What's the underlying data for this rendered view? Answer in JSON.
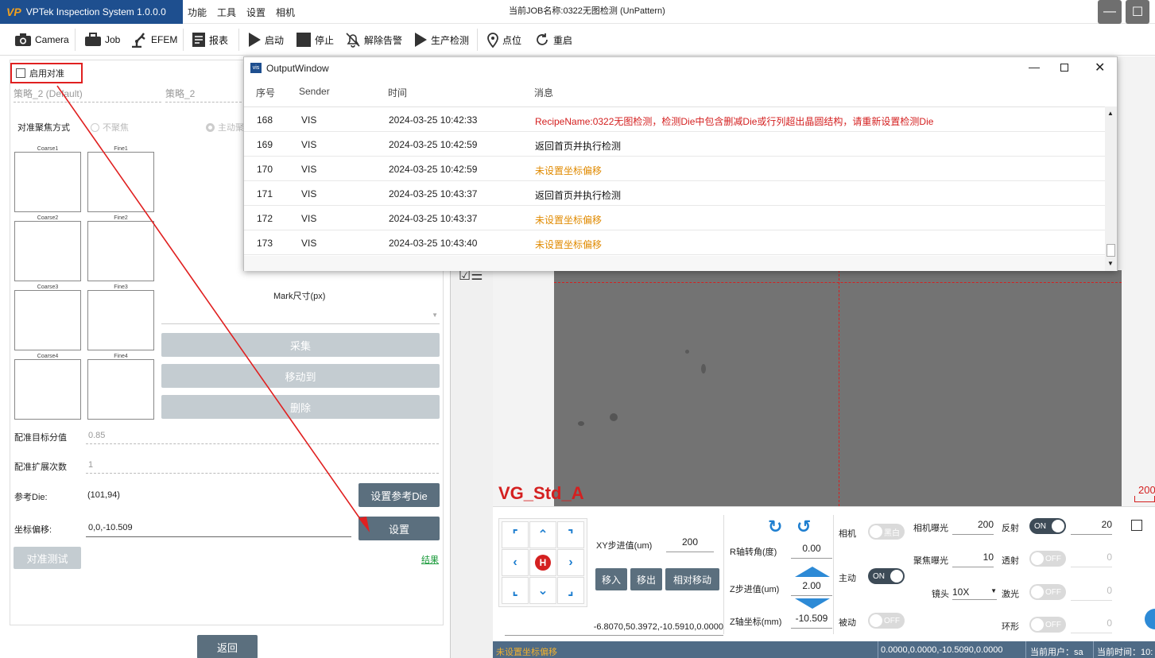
{
  "app": {
    "title": "VPTek Inspection System 1.0.0.0",
    "logo_text": "VP"
  },
  "menu": [
    "功能",
    "工具",
    "设置",
    "相机"
  ],
  "job_label": "当前JOB名称:0322无图检测 (UnPattern)",
  "window_buttons": {
    "minimize": "—",
    "maximize": "☐"
  },
  "toolbar": [
    {
      "label": "Camera",
      "icon": "camera-icon"
    },
    {
      "label": "Job",
      "icon": "briefcase-icon"
    },
    {
      "label": "EFEM",
      "icon": "robot-arm-icon"
    },
    {
      "label": "报表",
      "icon": "report-icon"
    },
    {
      "label": "启动",
      "icon": "play-icon"
    },
    {
      "label": "停止",
      "icon": "stop-icon"
    },
    {
      "label": "解除告警",
      "icon": "bell-off-icon"
    },
    {
      "label": "生产检测",
      "icon": "play-icon"
    },
    {
      "label": "点位",
      "icon": "location-pin-icon"
    },
    {
      "label": "重启",
      "icon": "restart-icon"
    }
  ],
  "align": {
    "enable_label": "启用对准",
    "strategy1": "策略_2 (Default)",
    "strategy2": "策略_2",
    "focus_mode_label": "对准聚焦方式",
    "focus_opt1": "不聚焦",
    "focus_opt2": "主动聚",
    "thumbs": [
      {
        "coarse": "Coarse1",
        "fine": "Fine1"
      },
      {
        "coarse": "Coarse2",
        "fine": "Fine2"
      },
      {
        "coarse": "Coarse3",
        "fine": "Fine3"
      },
      {
        "coarse": "Coarse4",
        "fine": "Fine4"
      }
    ],
    "mark_size_label": "Mark尺寸(px)",
    "btn_collect": "采集",
    "btn_move_to": "移动到",
    "btn_delete": "删除",
    "target_score_label": "配准目标分值",
    "target_score": "0.85",
    "expand_count_label": "配准扩展次数",
    "expand_count": "1",
    "ref_die_label": "参考Die:",
    "ref_die": "(101,94)",
    "btn_set_ref_die": "设置参考Die",
    "offset_label": "坐标偏移:",
    "offset": "0,0,-10.509",
    "btn_set": "设置",
    "btn_align_test": "对准测试",
    "result_link": "结果",
    "btn_return": "返回"
  },
  "output_window": {
    "title": "OutputWindow",
    "icon_text": "vis",
    "columns": [
      "序号",
      "Sender",
      "时间",
      "消息"
    ],
    "rows": [
      {
        "id": "168",
        "sender": "VIS",
        "time": "2024-03-25 10:42:33",
        "msg": "RecipeName:0322无图检测，检测Die中包含删减Die或行列超出晶圆结构，请重新设置检测Die",
        "level": "error"
      },
      {
        "id": "169",
        "sender": "VIS",
        "time": "2024-03-25 10:42:59",
        "msg": "返回首页并执行检测",
        "level": "info"
      },
      {
        "id": "170",
        "sender": "VIS",
        "time": "2024-03-25 10:42:59",
        "msg": "未设置坐标偏移",
        "level": "warn"
      },
      {
        "id": "171",
        "sender": "VIS",
        "time": "2024-03-25 10:43:37",
        "msg": "返回首页并执行检测",
        "level": "info"
      },
      {
        "id": "172",
        "sender": "VIS",
        "time": "2024-03-25 10:43:37",
        "msg": "未设置坐标偏移",
        "level": "warn"
      },
      {
        "id": "173",
        "sender": "VIS",
        "time": "2024-03-25 10:43:40",
        "msg": "未设置坐标偏移",
        "level": "warn"
      }
    ],
    "colors": {
      "error": "#d42020",
      "info": "#111111",
      "warn": "#e08a00"
    }
  },
  "image": {
    "label": "VG_Std_A",
    "scale": "200"
  },
  "control": {
    "home_label": "H",
    "xy_step_label": "XY步进值(um)",
    "xy_step": "200",
    "btn_move_in": "移入",
    "btn_move_out": "移出",
    "btn_relative_move": "相对移动",
    "coords": "-6.8070,50.3972,-10.5910,0.0000",
    "r_angle_label": "R轴转角(度)",
    "r_angle": "0.00",
    "z_step_label": "Z步进值(um)",
    "z_step": "2.00",
    "z_coord_label": "Z轴坐标(mm)",
    "z_coord": "-10.509",
    "camera_label": "相机",
    "camera_toggle": "黑白",
    "active_label": "主动",
    "active_toggle": "ON",
    "passive_label": "被动",
    "passive_toggle": "OFF",
    "cam_exposure_label": "相机曝光",
    "cam_exposure": "200",
    "focus_exposure_label": "聚焦曝光",
    "focus_exposure": "10",
    "lens_label": "镜头",
    "lens": "10X",
    "reflect_label": "反射",
    "reflect_toggle": "ON",
    "reflect_val": "20",
    "transmit_label": "透射",
    "transmit_toggle": "OFF",
    "transmit_val": "0",
    "laser_label": "激光",
    "laser_toggle": "OFF",
    "laser_val": "0",
    "ring_label": "环形",
    "ring_toggle": "OFF",
    "ring_val": "0"
  },
  "status": {
    "message": "未设置坐标偏移",
    "coords": "0.0000,0.0000,-10.5090,0.0000",
    "user": "当前用户：sa",
    "time": "当前时间：10:"
  }
}
